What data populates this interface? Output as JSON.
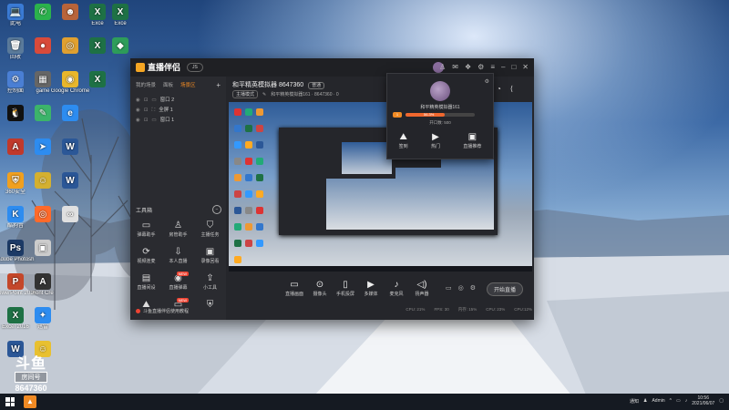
{
  "desktop": {
    "icons": [
      {
        "label": "此电",
        "color": "#3a7bd5",
        "glyph": "💻"
      },
      {
        "label": "",
        "color": "#2bb24c",
        "glyph": "✆"
      },
      {
        "label": "",
        "color": "#b8643a",
        "glyph": "☻"
      },
      {
        "label": "Exce",
        "color": "#1e7145",
        "glyph": "X"
      },
      {
        "label": "Exce",
        "color": "#1e7145",
        "glyph": "X"
      },
      {
        "label": "回收",
        "color": "#5a7a9a",
        "glyph": "🗑"
      },
      {
        "label": "",
        "color": "#d84a3a",
        "glyph": "●"
      },
      {
        "label": "",
        "color": "#e0a030",
        "glyph": "◎"
      },
      {
        "label": "",
        "color": "#1e7145",
        "glyph": "X"
      },
      {
        "label": "控制面",
        "color": "#4a7fd4",
        "glyph": "⚙"
      },
      {
        "label": "game",
        "color": "#666666",
        "glyph": "▦"
      },
      {
        "label": "Google Chrome",
        "color": "#e8b62c",
        "glyph": "◉"
      },
      {
        "label": "",
        "color": "#1e7145",
        "glyph": "X"
      },
      {
        "label": "",
        "color": "#2e9d5a",
        "glyph": "◆"
      },
      {
        "label": "",
        "color": "#111111",
        "glyph": "🐧"
      },
      {
        "label": "",
        "color": "#3cb46a",
        "glyph": "✎"
      },
      {
        "label": "",
        "color": "#c0392b",
        "glyph": "A"
      },
      {
        "label": "",
        "color": "#2d8cf0",
        "glyph": "➤"
      },
      {
        "label": "",
        "color": "#2d8cf0",
        "glyph": "e"
      },
      {
        "label": "360安全",
        "color": "#f0a020",
        "glyph": "⛨"
      },
      {
        "label": "",
        "color": "#d4b030",
        "glyph": "☺"
      },
      {
        "label": "",
        "color": "#2b5797",
        "glyph": "W"
      },
      {
        "label": "酷狗音",
        "color": "#2d8cf0",
        "glyph": "K"
      },
      {
        "label": "",
        "color": "#ff6a2a",
        "glyph": "◎"
      },
      {
        "label": "",
        "color": "#2b5797",
        "glyph": "W"
      },
      {
        "label": "Adobe Photosh",
        "color": "#1c3a66",
        "glyph": "Ps"
      },
      {
        "label": "",
        "color": "#cccccc",
        "glyph": "▣"
      },
      {
        "label": "",
        "color": "#e0e0e0",
        "glyph": "∞"
      },
      {
        "label": "PowerPoint 2016",
        "color": "#c4472a",
        "glyph": "P"
      },
      {
        "label": "Font Cre",
        "color": "#333333",
        "glyph": "A"
      },
      {
        "label": "Excel 2016",
        "color": "#1e7145",
        "glyph": "X"
      },
      {
        "label": "迅雷",
        "color": "#2d8cf0",
        "glyph": "✦"
      },
      {
        "label": "",
        "color": "#2b5797",
        "glyph": "W"
      },
      {
        "label": "",
        "color": "#e8c030",
        "glyph": "☺"
      }
    ]
  },
  "watermark": {
    "logo": "斗鱼",
    "box": "房间号",
    "number": "8647360"
  },
  "app": {
    "brand": "直播伴侣",
    "brand_pill": "JS",
    "tabs": [
      "我的场景",
      "面板",
      "场景区"
    ],
    "scenes": [
      "窗口 2",
      "全屏 1",
      "窗口 1"
    ],
    "tools_title": "工具箱",
    "tools": [
      {
        "label": "弹幕助手",
        "glyph": "▭",
        "badge": ""
      },
      {
        "label": "房管助手",
        "glyph": "♙",
        "badge": ""
      },
      {
        "label": "主播任务",
        "glyph": "⛉",
        "badge": ""
      },
      {
        "label": "视频连麦",
        "glyph": "⟳",
        "badge": ""
      },
      {
        "label": "本人直播",
        "glyph": "⇩",
        "badge": ""
      },
      {
        "label": "录像回看",
        "glyph": "▣",
        "badge": ""
      },
      {
        "label": "直播间设",
        "glyph": "▤",
        "badge": ""
      },
      {
        "label": "直播弹幕",
        "glyph": "◉",
        "badge": "NEW"
      },
      {
        "label": "小工具",
        "glyph": "⇪",
        "badge": ""
      },
      {
        "label": "",
        "glyph": "⛰",
        "badge": ""
      },
      {
        "label": "",
        "glyph": "▭",
        "badge": "NEW"
      },
      {
        "label": "",
        "glyph": "⛨",
        "badge": ""
      }
    ],
    "bottom_note": "斗鱼直播伴侣使用教程",
    "room_title": "和平精英模拟器 8647360",
    "room_vip": "普通",
    "room_chip": "主播模式",
    "room_meta": "和平精英模拟器161 · 8647360 · 0",
    "controls": [
      "直播画面",
      "摄像头",
      "手机投屏",
      "多媒体",
      "麦克风",
      "扬声器"
    ],
    "start_btn": "开始直播",
    "status": [
      "CPU: 21%",
      "FPS: 30",
      "内存: 15%",
      "CPU: 23%",
      "CPU:12%"
    ]
  },
  "popup": {
    "name": "和平精英模拟器161",
    "level": "1",
    "progress_label": "56.3%",
    "progress": 0.56,
    "growth": "开口数: 500",
    "actions": [
      {
        "label": "签到",
        "glyph": "⛰"
      },
      {
        "label": "热门",
        "glyph": "▶"
      },
      {
        "label": "直播推荐",
        "glyph": "▣"
      }
    ]
  },
  "taskbar": {
    "tray_user": "Admin",
    "time": "10:56",
    "date": "2021/06/07",
    "tray_net": "通知"
  }
}
